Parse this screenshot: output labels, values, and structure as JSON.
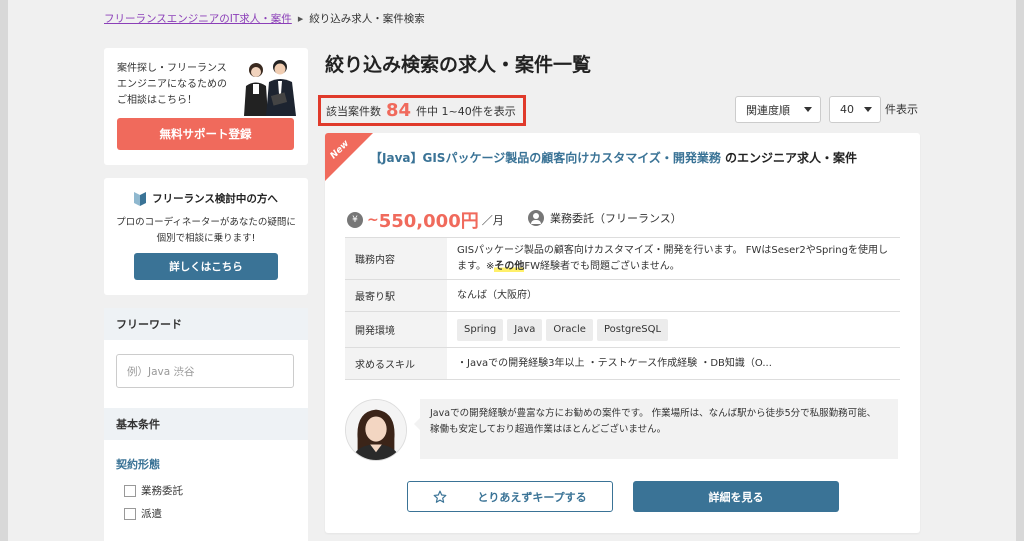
{
  "breadcrumb": {
    "home": "フリーランスエンジニアのIT求人・案件",
    "current": "絞り込み求人・案件検索"
  },
  "sidebar": {
    "support": {
      "text": "案件探し・フリーランスエンジニアになるためのご相談はこちら！",
      "button": "無料サポート登録"
    },
    "consider": {
      "title": "フリーランス検討中の方へ",
      "desc": "プロのコーディネーターがあなたの疑問に個別で相談に乗ります!",
      "button": "詳しくはこちら"
    },
    "freeword": {
      "heading": "フリーワード",
      "placeholder": "例）Java 渋谷"
    },
    "basic": {
      "heading": "基本条件",
      "contract_label": "契約形態",
      "options": [
        "業務委託",
        "派遣"
      ]
    }
  },
  "main": {
    "title": "絞り込み検索の求人・案件一覧",
    "count": {
      "prefix": "該当案件数",
      "number": "84",
      "suffix": "件中 1~40件を表示"
    },
    "sort": {
      "selected": "関連度順"
    },
    "per_page": {
      "selected": "40",
      "suffix": "件表示"
    }
  },
  "job": {
    "badge": "New",
    "title_link": "【Java】GISパッケージ製品の顧客向けカスタマイズ・開発業務",
    "title_suffix": "のエンジニア求人・案件",
    "salary_tilde": "~",
    "salary": "550,000円",
    "salary_unit": "／月",
    "contract": "業務委託（フリーランス）",
    "rows": {
      "duties_label": "職務内容",
      "duties_text_1": "GISパッケージ製品の顧客向けカスタマイズ・開発を行います。 FWはSeser2やSpringを使用します。※",
      "duties_highlight": "その他",
      "duties_text_2": "FW経験者でも問題ございません。",
      "station_label": "最寄り駅",
      "station_value": "なんば（大阪府）",
      "env_label": "開発環境",
      "env_tags": [
        "Spring",
        "Java",
        "Oracle",
        "PostgreSQL"
      ],
      "skills_label": "求めるスキル",
      "skills_value": "・Javaでの開発経験3年以上 ・テストケース作成経験 ・DB知識（O..."
    },
    "comment": "Javaでの開発経験が豊富な方にお勧めの案件です。 作業場所は、なんば駅から徒歩5分で私服勤務可能、 稼働も安定しており超過作業はほとんどございません。",
    "keep_button": "とりあえずキープする",
    "detail_button": "詳細を見る"
  },
  "colors": {
    "accent": "#f06a5c",
    "primary": "#3a7396",
    "highlight_box": "#e03a2b"
  }
}
